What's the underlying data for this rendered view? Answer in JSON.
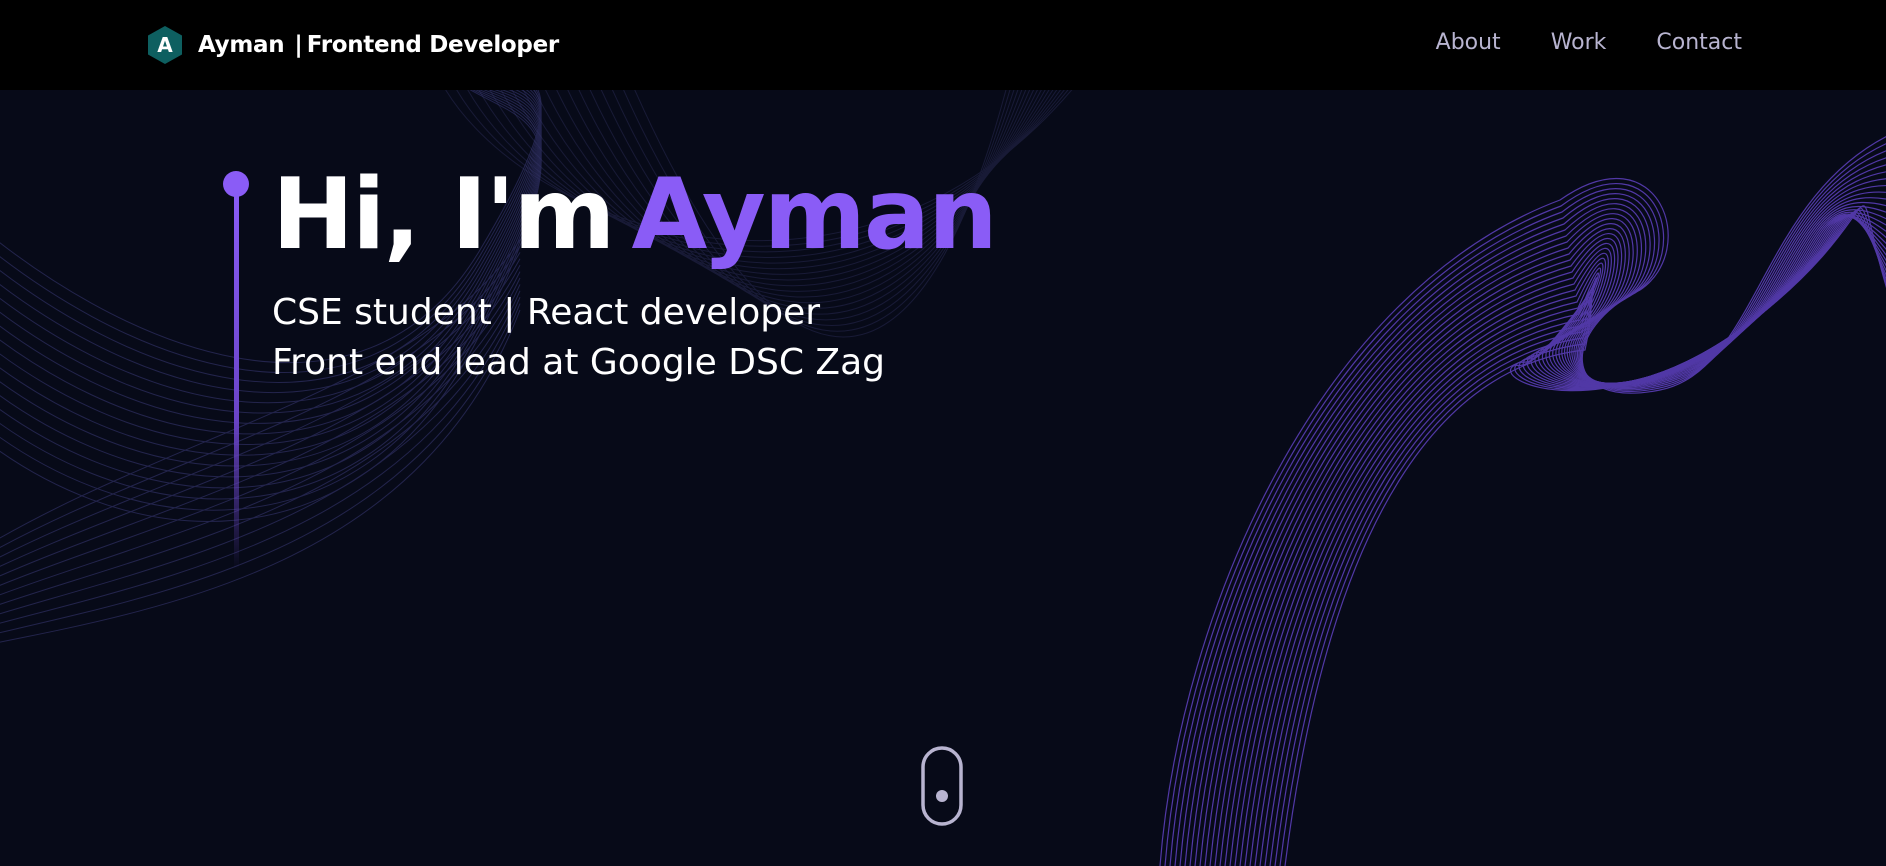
{
  "header": {
    "logo_letter": "A",
    "brand_name": "Ayman",
    "brand_separator": "|",
    "brand_role": "Frontend Developer",
    "nav": [
      {
        "label": "About"
      },
      {
        "label": "Work"
      },
      {
        "label": "Contact"
      }
    ]
  },
  "hero": {
    "greeting": "Hi, I'm",
    "name": "Ayman",
    "subtitle_line1": "CSE student | React developer",
    "subtitle_line2": "Front end lead at Google DSC Zag"
  },
  "icons": {
    "logo": "hexagon-logo-icon",
    "scroll": "mouse-scroll-icon"
  },
  "colors": {
    "background": "#070a18",
    "header": "#000000",
    "accent": "#8a5cf6",
    "logo": "#0e5f60",
    "nav_text": "#b8b4d0",
    "text": "#ffffff"
  }
}
